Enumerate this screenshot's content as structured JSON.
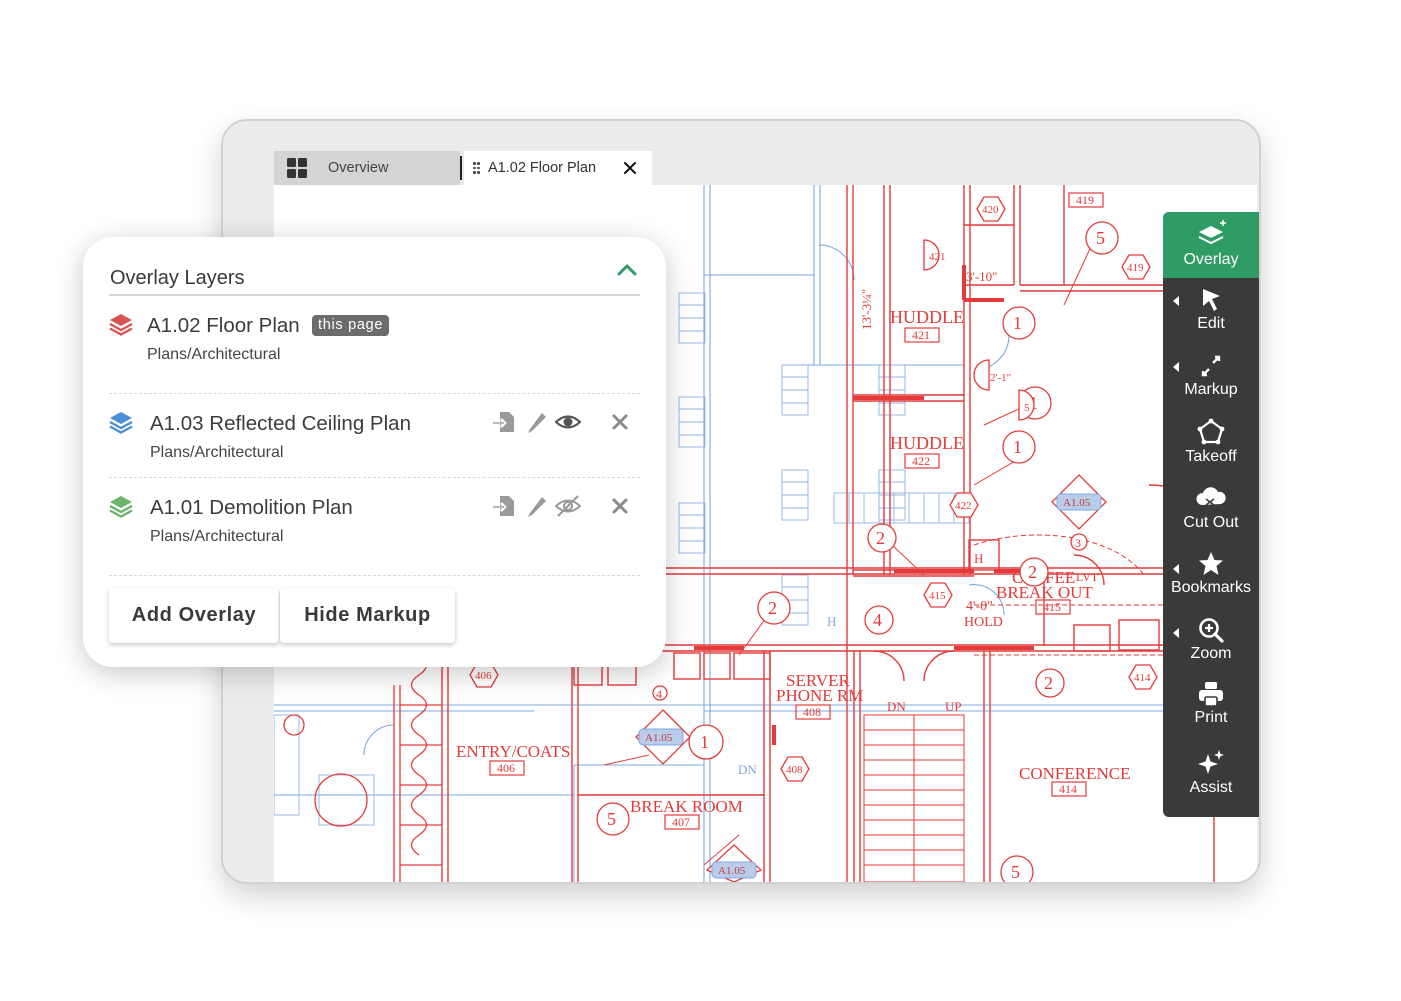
{
  "tabs": {
    "overview_label": "Overview",
    "active_label": "A1.02 Floor Plan"
  },
  "overlay_panel": {
    "title": "Overlay Layers",
    "current_badge": "this page",
    "layers": [
      {
        "name": "A1.02 Floor Plan",
        "path": "Plans/Architectural",
        "color": "#d9534f",
        "visible": true
      },
      {
        "name": "A1.03 Reflected Ceiling Plan",
        "path": "Plans/Architectural",
        "color": "#4a90d9",
        "visible": true
      },
      {
        "name": "A1.01 Demolition Plan",
        "path": "Plans/Architectural",
        "color": "#6cb46c",
        "visible": false
      }
    ],
    "buttons": {
      "add": "Add Overlay",
      "hide": "Hide Markup"
    }
  },
  "toolbar": {
    "accent": "#2f9b65",
    "tools": [
      {
        "label": "Overlay",
        "icon": "layers-plus-icon"
      },
      {
        "label": "Edit",
        "icon": "cursor-icon"
      },
      {
        "label": "Markup",
        "icon": "expand-arrows-icon"
      },
      {
        "label": "Takeoff",
        "icon": "polygon-icon"
      },
      {
        "label": "Cut Out",
        "icon": "cloud-scissors-icon"
      },
      {
        "label": "Bookmarks",
        "icon": "star-icon"
      },
      {
        "label": "Zoom",
        "icon": "zoom-in-icon"
      },
      {
        "label": "Print",
        "icon": "printer-icon"
      },
      {
        "label": "Assist",
        "icon": "sparkle-icon"
      }
    ]
  },
  "drawing": {
    "rooms": [
      {
        "name": "HUDDLE",
        "number": "421"
      },
      {
        "name": "HUDDLE",
        "number": "422"
      },
      {
        "name": "COFFEE",
        "name2": "BREAK OUT",
        "number": "415"
      },
      {
        "name": "SERVER",
        "name2": "PHONE RM",
        "number": "408"
      },
      {
        "name": "ENTRY/COATS",
        "number": "406"
      },
      {
        "name": "BREAK ROOM",
        "number": "407"
      },
      {
        "name": "CONFERENCE",
        "number": "414"
      }
    ],
    "tags": [
      "420",
      "419",
      "419",
      "421",
      "422",
      "415",
      "414",
      "406",
      "408",
      "A1.05",
      "A1.05",
      "A1.05"
    ],
    "dimensions": [
      "3'-10\"",
      "13'-3 1/4\"",
      "2'-1\"",
      "4'-0\"",
      "HOLD",
      "LVT"
    ],
    "stairs": [
      "DN",
      "UP",
      "DN"
    ],
    "keynotes": [
      "1",
      "1",
      "1",
      "2",
      "2",
      "2",
      "3",
      "4",
      "4",
      "5",
      "5",
      "5",
      "5",
      "H",
      "H"
    ]
  }
}
